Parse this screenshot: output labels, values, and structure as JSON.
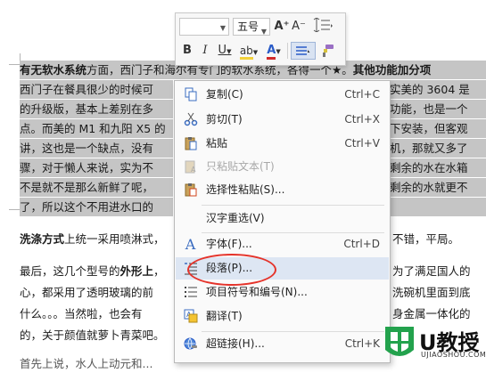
{
  "document": {
    "line1": {
      "bold_a": "有无软水系统",
      "text_a": "方面，西门子和海尔有专门的软水系统，各得一个★。",
      "bold_b": "其他功能加分项"
    },
    "line2": {
      "left": "西门子在餐具很少的时候可",
      "right": "实美的 3604 是"
    },
    "line3": {
      "left": "的升级版，基本上差别在多",
      "right": "功能，也是一个"
    },
    "line4": {
      "left": "点。而美的 M1 和九阳 X5 的",
      "right": "下安装，但客观"
    },
    "line5": {
      "left": "讲，这也是一个缺点，没有",
      "right": "机，那就又多了"
    },
    "line6": {
      "left": "骤，对于懒人来说，实为不",
      "right": "剩余的水在水箱"
    },
    "line7": {
      "left": "不是就不是那么新鲜了呢，",
      "right": "剩余的水就更不"
    },
    "line8": {
      "left": "了，所以这个不用进水口的",
      "right": ""
    },
    "line9": {
      "bold": "洗涤方式",
      "left": "上统一采用喷淋式，",
      "right": "不错，平局。"
    },
    "line10": {
      "left_a": "最后，这几个型号的",
      "bold": "外形上",
      "left_b": "，",
      "right": "为了满足国人的"
    },
    "line11": {
      "left": "心，都采用了透明玻璃的前",
      "right": "洗碗机里面到底"
    },
    "line12": {
      "left": "什么。。。当然啦，也会有",
      "right": "身金属一体化的"
    },
    "line13": {
      "left": "的，关于颜值就萝卜青菜吧。",
      "right": ""
    },
    "line14": {
      "left": "首先上说，水人上动元和..."
    }
  },
  "mini_toolbar": {
    "font_value": "",
    "size_value": "五号",
    "grow_font": "A⁺",
    "shrink_font": "A⁻",
    "bold": "B",
    "italic": "I",
    "underline": "U",
    "highlight": "ab",
    "font_color": "A",
    "accent_color": "#2a5cc8",
    "highlight_color": "#f2d23a",
    "font_color_bar": "#d12a2a"
  },
  "context_menu": {
    "items": [
      {
        "label": "复制(C)",
        "shortcut": "Ctrl+C",
        "icon": "copy-icon",
        "disabled": false
      },
      {
        "label": "剪切(T)",
        "shortcut": "Ctrl+X",
        "icon": "scissors-icon",
        "disabled": false
      },
      {
        "label": "粘贴",
        "shortcut": "Ctrl+V",
        "icon": "paste-icon",
        "disabled": false
      },
      {
        "label": "只粘贴文本(T)",
        "shortcut": "",
        "icon": "paste-text-icon",
        "disabled": true
      },
      {
        "label": "选择性粘贴(S)...",
        "shortcut": "",
        "icon": "paste-special-icon",
        "disabled": false
      },
      {
        "label": "汉字重选(V)",
        "shortcut": "",
        "icon": "",
        "disabled": false
      },
      {
        "label": "字体(F)...",
        "shortcut": "Ctrl+D",
        "icon": "font-icon",
        "disabled": false
      },
      {
        "label": "段落(P)...",
        "shortcut": "",
        "icon": "paragraph-icon",
        "disabled": false
      },
      {
        "label": "项目符号和编号(N)...",
        "shortcut": "",
        "icon": "bullets-icon",
        "disabled": false
      },
      {
        "label": "翻译(T)",
        "shortcut": "",
        "icon": "translate-icon",
        "disabled": false
      },
      {
        "label": "超链接(H)...",
        "shortcut": "Ctrl+K",
        "icon": "hyperlink-icon",
        "disabled": false
      }
    ],
    "highlight_color": "#e5332a"
  },
  "watermark": {
    "text": "U教授",
    "url_text": "UJIAOSHOU.COM"
  }
}
